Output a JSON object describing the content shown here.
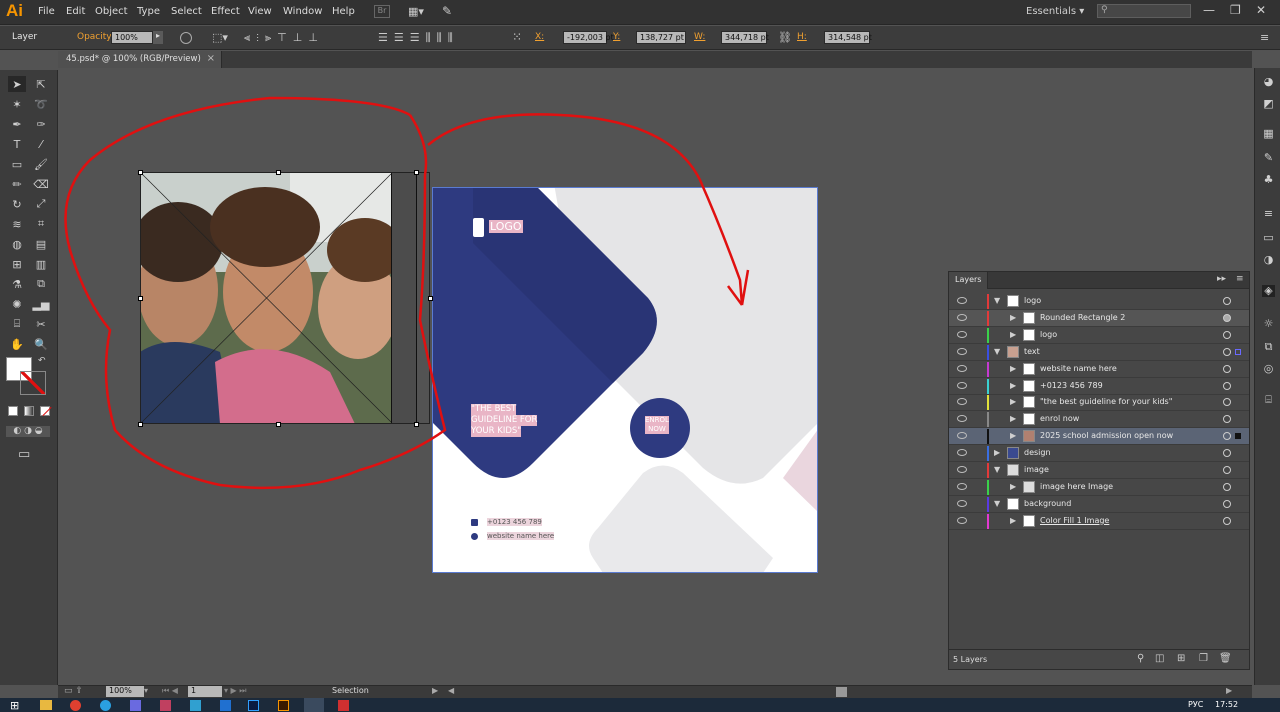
{
  "app": {
    "logo_text": "Ai",
    "accent": "#f79500"
  },
  "menubar": {
    "items": [
      "File",
      "Edit",
      "Object",
      "Type",
      "Select",
      "Effect",
      "View",
      "Window",
      "Help"
    ],
    "workspace": "Essentials"
  },
  "control_bar": {
    "selection_label": "Layer",
    "opacity_label": "Opacity:",
    "opacity_value": "100%",
    "x_label": "X:",
    "x_value": "-192,003 pt",
    "y_label": "Y:",
    "y_value": "138,727 pt",
    "w_label": "W:",
    "w_value": "344,718 pt",
    "h_label": "H:",
    "h_value": "314,548 pt"
  },
  "document_tab": {
    "title": "45.psd* @ 100% (RGB/Preview)",
    "close": "×"
  },
  "artboard": {
    "logo_text": "LOGO",
    "headline": [
      "\"THE BEST",
      "GUIDELINE FOR",
      "YOUR KIDS\""
    ],
    "enrol": [
      "ENROL",
      "NOW"
    ],
    "phone": "+0123 456 789",
    "website": "website name here",
    "colors": {
      "navy": "#2e3a80",
      "light_gray": "#e5e5e7",
      "pink": "#ead6de"
    }
  },
  "layers_panel": {
    "title": "Layers",
    "footer_count": "5 Layers",
    "rows": [
      {
        "name": "logo",
        "indent": 0,
        "expanded": true,
        "color": "#e23a3a"
      },
      {
        "name": "Rounded Rectangle 2",
        "indent": 1,
        "expanded": false,
        "color": "#e23a3a"
      },
      {
        "name": "logo",
        "indent": 1,
        "expanded": false,
        "color": "#3ad14a"
      },
      {
        "name": "text",
        "indent": 0,
        "expanded": true,
        "color": "#3a4fe2"
      },
      {
        "name": "website name here",
        "indent": 1,
        "expanded": false,
        "color": "#c43ad1"
      },
      {
        "name": "+0123 456 789",
        "indent": 1,
        "expanded": false,
        "color": "#3ad1d1"
      },
      {
        "name": "\"the best guideline for your kids\"",
        "indent": 1,
        "expanded": false,
        "color": "#e2e23a"
      },
      {
        "name": "enrol now",
        "indent": 1,
        "expanded": false,
        "color": "#888888"
      },
      {
        "name": "2025 school admission open now",
        "indent": 1,
        "expanded": false,
        "color": "#111111"
      },
      {
        "name": "design",
        "indent": 0,
        "expanded": false,
        "color": "#3a6fe2"
      },
      {
        "name": "image",
        "indent": 0,
        "expanded": true,
        "color": "#e23a3a"
      },
      {
        "name": "image here Image",
        "indent": 1,
        "expanded": false,
        "color": "#3ad14a"
      },
      {
        "name": "background",
        "indent": 0,
        "expanded": true,
        "color": "#5a3ae2"
      },
      {
        "name": "Color Fill 1 Image",
        "indent": 1,
        "expanded": false,
        "color": "#e23ad1"
      }
    ]
  },
  "status_bar": {
    "zoom": "100%",
    "page": "1",
    "tool": "Selection"
  },
  "taskbar": {
    "lang": "РУС",
    "time": "17:52"
  }
}
